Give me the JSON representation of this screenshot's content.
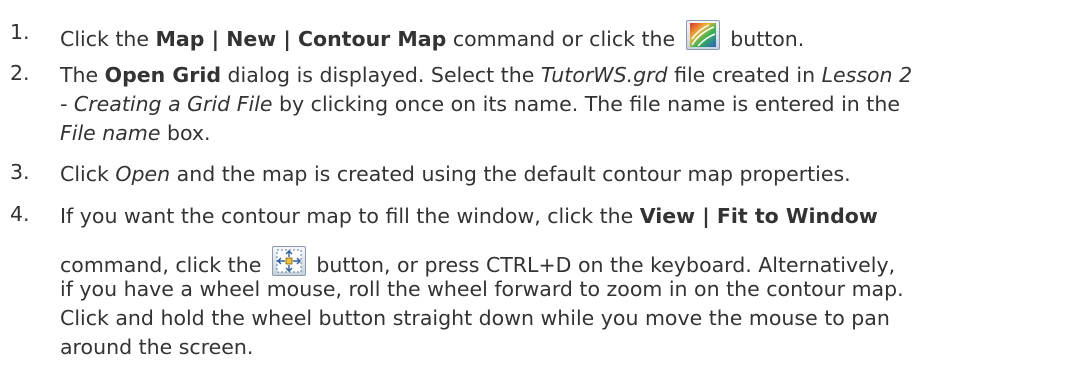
{
  "steps": [
    {
      "number": "1.",
      "text1": "Click the ",
      "command": "Map | New | Contour Map",
      "text2": " command or click the ",
      "icon": "contour-map-icon",
      "text3": " button."
    },
    {
      "number": "2.",
      "text1": "The ",
      "dialog": "Open Grid",
      "text2": " dialog is displayed. Select the ",
      "file": "TutorWS.grd",
      "text3": " file created in ",
      "lesson_a": "Lesson 2",
      "lesson_b": "- Creating a Grid File",
      "text4": " by clicking once on its name. The file name is entered in the",
      "field": "File name",
      "text5": " box."
    },
    {
      "number": "3.",
      "text1": "Click ",
      "action": "Open",
      "text2": " and the map is created using the default contour map properties."
    },
    {
      "number": "4.",
      "text1": "If you want the contour map to fill the window, click the ",
      "command": "View | Fit to Window",
      "text2": "command, click the ",
      "icon": "fit-to-window-icon",
      "text3": " button, or press CTRL+D on the keyboard. Alternatively,",
      "line3": "if you have a wheel mouse, roll the wheel forward to zoom in on the contour map.",
      "line4": "Click and hold the wheel button straight down while you move the mouse to pan",
      "line5": "around the screen."
    }
  ]
}
